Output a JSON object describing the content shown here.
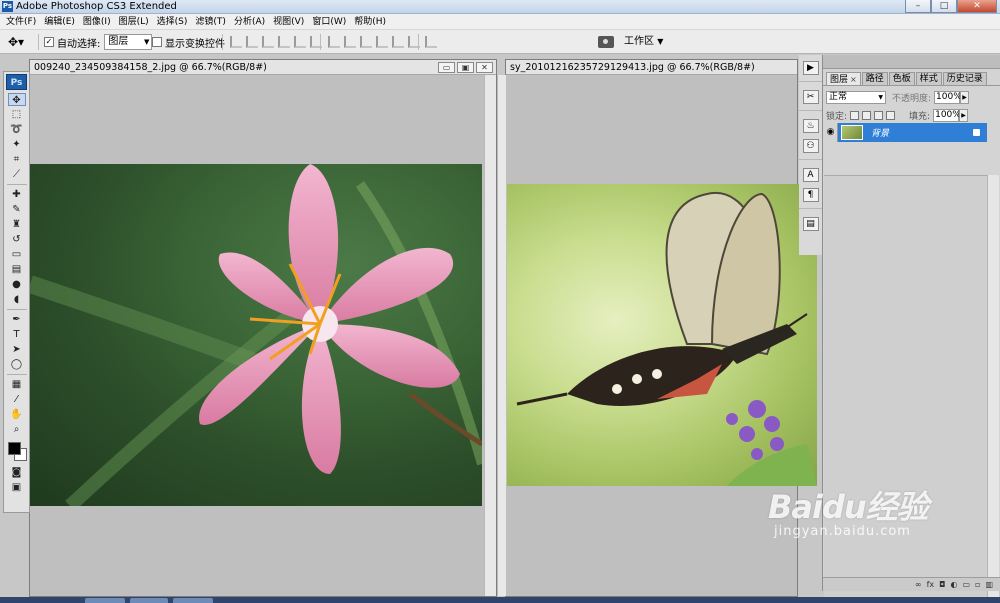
{
  "app": {
    "logo_text": "Ps",
    "title": "Adobe Photoshop CS3 Extended",
    "window_buttons": [
      "–",
      "□",
      "✕"
    ]
  },
  "menu": [
    "文件(F)",
    "编辑(E)",
    "图像(I)",
    "图层(L)",
    "选择(S)",
    "滤镜(T)",
    "分析(A)",
    "视图(V)",
    "窗口(W)",
    "帮助(H)"
  ],
  "options_bar": {
    "auto_select_label": "自动选择:",
    "auto_select_checked": true,
    "auto_select_value": "图层",
    "show_transform_label": "显示变换控件",
    "show_transform_checked": false,
    "workspace_label": "工作区",
    "workspace_caret": "▼"
  },
  "documents": [
    {
      "title": "009240_234509384158_2.jpg @ 66.7%(RGB/8#)",
      "buttons": [
        "▭",
        "▣",
        "✕"
      ],
      "image": "pink-lily-flower-photo"
    },
    {
      "title": "sy_20101216235729129413.jpg @ 66.7%(RGB/8#)",
      "image": "butterfly-on-flowers-photo"
    }
  ],
  "layers_panel": {
    "tabs": [
      "图层",
      "路径",
      "色板",
      "样式",
      "历史记录"
    ],
    "tab_close": "×",
    "blend_mode": "正常",
    "opacity_label": "不透明度:",
    "opacity_value": "100%",
    "lock_label": "锁定:",
    "fill_label": "填充:",
    "fill_value": "100%",
    "layer": {
      "name": "背景",
      "visible": true,
      "locked": true
    },
    "footer_icons": [
      "link-icon",
      "fx-icon",
      "mask-icon",
      "adjustment-icon",
      "group-icon",
      "new-layer-icon",
      "trash-icon"
    ]
  },
  "toolbox": {
    "logo_text": "Ps",
    "tools": [
      "move",
      "marquee",
      "lasso",
      "magic-wand",
      "crop",
      "slice",
      "healing",
      "brush",
      "clone-stamp",
      "history-brush",
      "eraser",
      "gradient",
      "blur",
      "dodge",
      "pen",
      "type",
      "path-select",
      "shape",
      "notes",
      "eyedropper",
      "hand",
      "zoom"
    ],
    "foreground_color": "#000000",
    "background_color": "#ffffff"
  },
  "watermark": {
    "brand": "Baidu经验",
    "url": "jingyan.baidu.com"
  },
  "colors": {
    "selection_blue": "#2f7fd6",
    "ps_blue": "#1f5fa8"
  }
}
